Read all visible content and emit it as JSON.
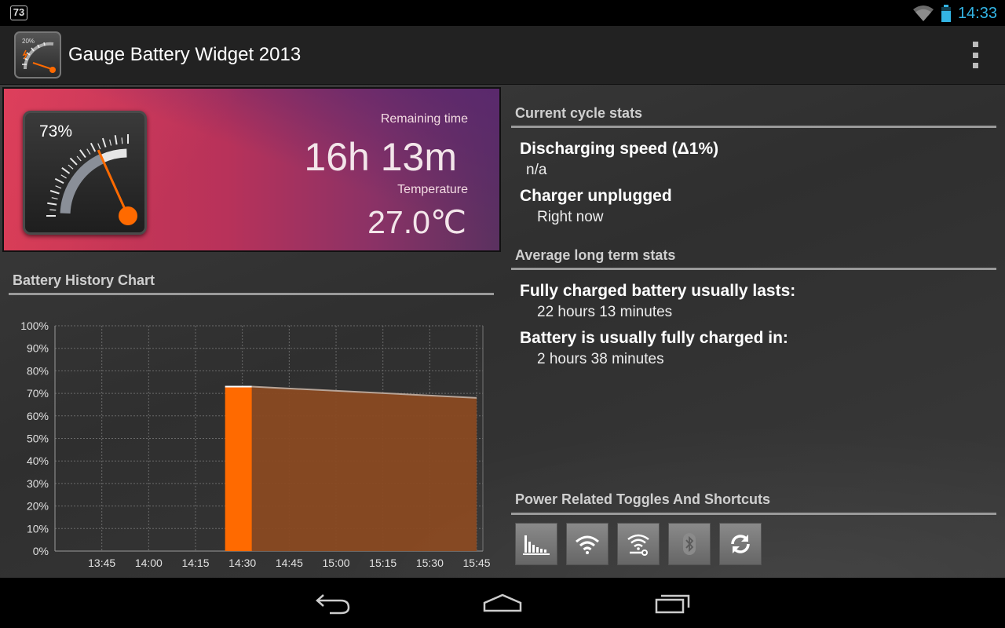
{
  "statusbar": {
    "notification_count": "73",
    "clock": "14:33"
  },
  "app": {
    "title": "Gauge Battery Widget 2013",
    "icon_label": "20%"
  },
  "gauge": {
    "percent_text": "73%",
    "level": 0.73,
    "remaining_label": "Remaining time",
    "remaining_value": "16h 13m",
    "temperature_label": "Temperature",
    "temperature_value": "27.0℃"
  },
  "history": {
    "title": "Battery History Chart"
  },
  "chart_data": {
    "type": "area",
    "title": "",
    "xlabel": "",
    "ylabel": "",
    "ylim": [
      0,
      100
    ],
    "y_ticks": [
      "0%",
      "10%",
      "20%",
      "30%",
      "40%",
      "50%",
      "60%",
      "70%",
      "80%",
      "90%",
      "100%"
    ],
    "x_ticks": [
      "13:45",
      "14:00",
      "14:15",
      "14:30",
      "14:45",
      "15:00",
      "15:15",
      "15:30",
      "15:45"
    ],
    "grid": true,
    "series": [
      {
        "kind": "bar",
        "x": "14:30",
        "value": 73
      },
      {
        "kind": "projection",
        "x": [
          "14:33",
          "15:45"
        ],
        "values": [
          73,
          68
        ]
      }
    ],
    "colors": {
      "bar": "#ff6a00",
      "projection": "#8a4a22"
    }
  },
  "current_stats": {
    "title": "Current cycle stats",
    "items": [
      {
        "label": "Discharging speed (Δ1%)",
        "value": "n/a"
      },
      {
        "label": "Charger unplugged",
        "value": "Right now"
      }
    ]
  },
  "long_term_stats": {
    "title": "Average long term stats",
    "items": [
      {
        "label": "Fully charged battery usually lasts:",
        "value": "22 hours 13 minutes"
      },
      {
        "label": "Battery is usually fully charged in:",
        "value": "2 hours 38 minutes"
      }
    ]
  },
  "toggles": {
    "title": "Power Related Toggles And Shortcuts",
    "items": [
      "usage-chart-icon",
      "wifi-icon",
      "wifi-settings-icon",
      "bluetooth-icon",
      "sync-icon"
    ]
  },
  "colors": {
    "accent": "#33b5e5",
    "orange": "#ff6a00"
  }
}
